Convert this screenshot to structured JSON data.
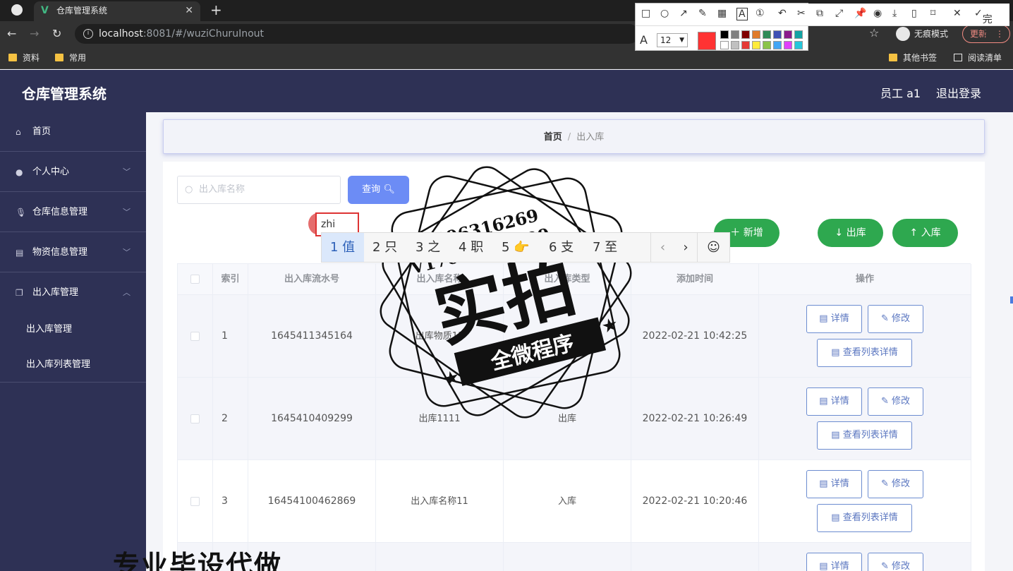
{
  "browser": {
    "tab_title": "仓库管理系统",
    "url_host": "localhost",
    "url_rest": ":8081/#/wuziChuruInout",
    "incognito_label": "无痕模式",
    "update_label": "更新",
    "bookmarks": [
      "资料",
      "常用"
    ],
    "bookmarks_right": [
      "其他书签",
      "阅读清单"
    ]
  },
  "annotation": {
    "done_label": "完成",
    "font_size": "12",
    "accent_color": "#ff3333",
    "palette_top": [
      "#000000",
      "#808080",
      "#800000",
      "#e07b2a",
      "#2e8b57",
      "#3f51b5",
      "#8b1a8b",
      "#13a3a3"
    ],
    "palette_bottom": [
      "#ffffff",
      "#c0c0c0",
      "#e53935",
      "#ffeb3b",
      "#8bc34a",
      "#42a5f5",
      "#e040fb",
      "#26c6da"
    ]
  },
  "app": {
    "title": "仓库管理系统",
    "user": "员工 a1",
    "logout": "退出登录",
    "header_color": "#2e3155"
  },
  "sidebar": {
    "items": [
      {
        "label": "首页",
        "icon": "home-icon"
      },
      {
        "label": "个人中心",
        "icon": "user-icon"
      },
      {
        "label": "仓库信息管理",
        "icon": "microphone-icon"
      },
      {
        "label": "物资信息管理",
        "icon": "document-icon"
      },
      {
        "label": "出入库管理",
        "icon": "copy-icon"
      }
    ],
    "subitems": [
      "出入库管理",
      "出入库列表管理"
    ]
  },
  "breadcrumb": {
    "home": "首页",
    "sep": "/",
    "current": "出入库"
  },
  "toolbar": {
    "search_placeholder": "出入库名称",
    "query_label": "查询",
    "add_label": "新增",
    "out_label": "出库",
    "in_label": "入库"
  },
  "table": {
    "headers": [
      "索引",
      "出入库流水号",
      "出入库名称",
      "出入库类型",
      "添加时间",
      "操作"
    ],
    "rows": [
      {
        "index": "1",
        "serial": "1645411345164",
        "name": "出库物质11",
        "type": "出库",
        "time": "2022-02-21 10:42:25"
      },
      {
        "index": "2",
        "serial": "1645410409299",
        "name": "出库1111",
        "type": "出库",
        "time": "2022-02-21 10:26:49"
      },
      {
        "index": "3",
        "serial": "16454100462869",
        "name": "出入库名称11",
        "type": "入库",
        "time": "2022-02-21 10:20:46"
      }
    ],
    "actions": {
      "detail": "详情",
      "edit": "修改",
      "list_detail": "查看列表详情"
    }
  },
  "ime": {
    "typed": "zhi",
    "candidates": [
      "1 值",
      "2 只",
      "3 之",
      "4 职",
      "5 👉",
      "6 支",
      "7 至"
    ]
  },
  "watermark": {
    "qq": "Q2196316269",
    "wechat": "V17080256499",
    "big": "实拍",
    "banner": "全微程序",
    "bottom": "专业毕设代做"
  }
}
